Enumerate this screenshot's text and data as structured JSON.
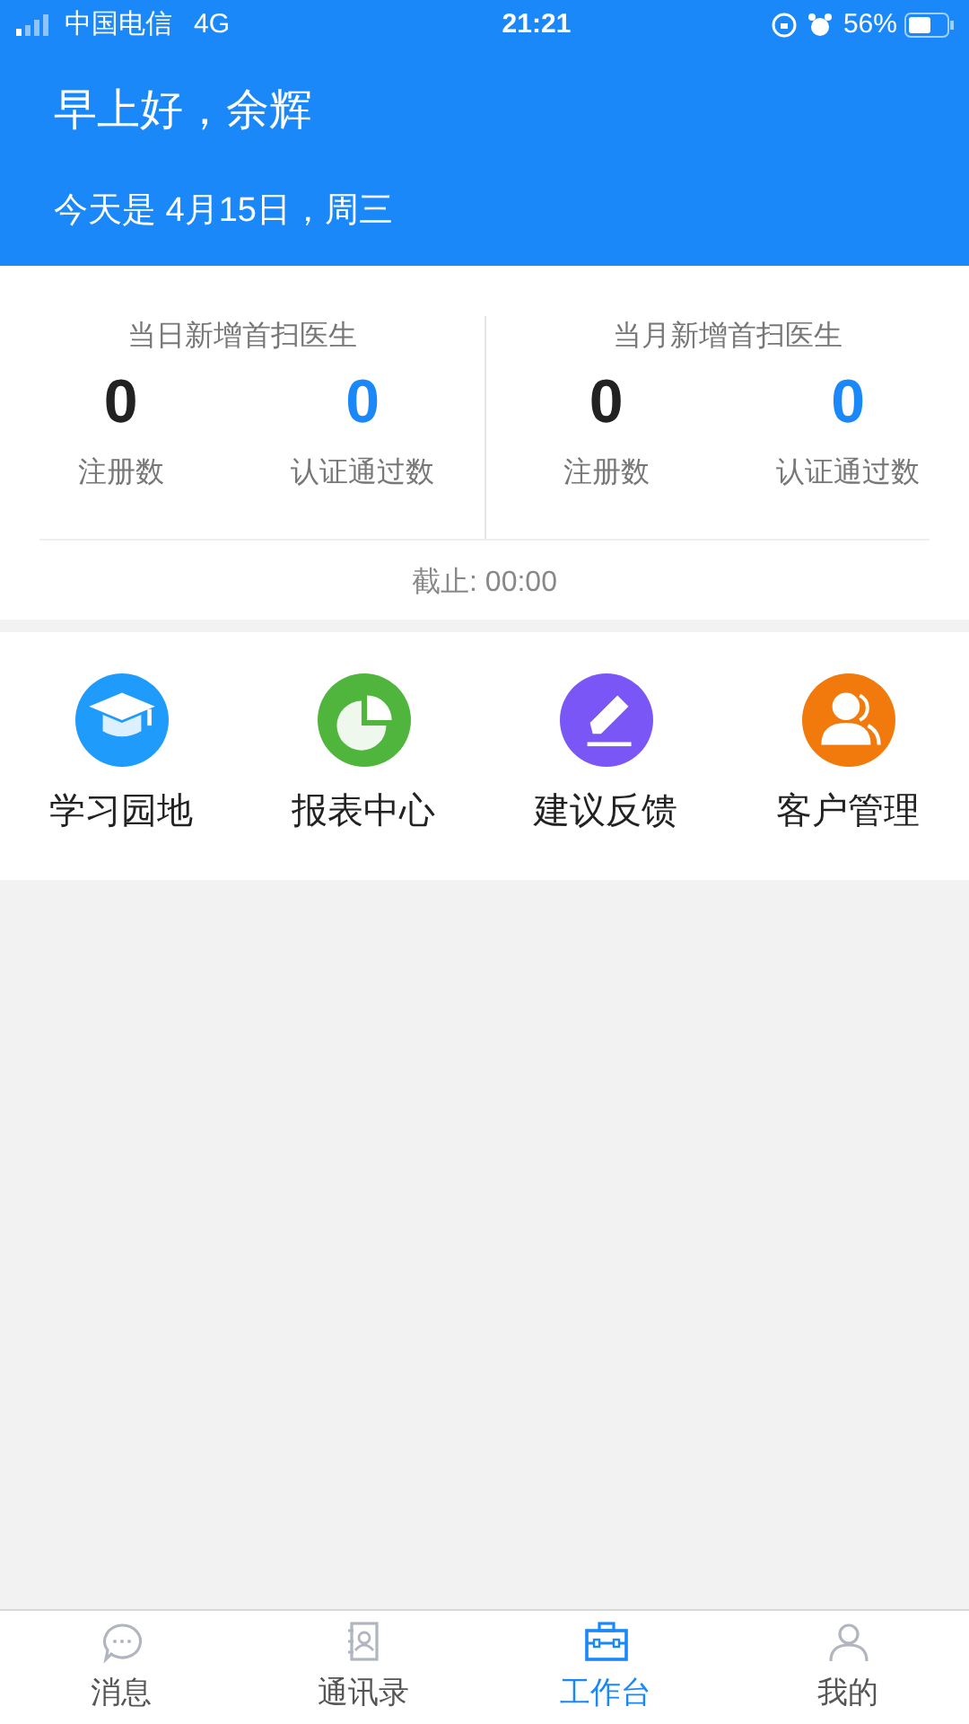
{
  "status_bar": {
    "carrier": "中国电信",
    "network": "4G",
    "time": "21:21",
    "battery": "56%"
  },
  "header": {
    "greeting": "早上好，余辉",
    "date": "今天是 4月15日，周三"
  },
  "stats": {
    "groups": [
      {
        "title": "当日新增首扫医生",
        "items": [
          {
            "value": "0",
            "label": "注册数",
            "color": "#222222"
          },
          {
            "value": "0",
            "label": "认证通过数",
            "color": "#1a88f8"
          }
        ]
      },
      {
        "title": "当月新增首扫医生",
        "items": [
          {
            "value": "0",
            "label": "注册数",
            "color": "#222222"
          },
          {
            "value": "0",
            "label": "认证通过数",
            "color": "#1a88f8"
          }
        ]
      }
    ],
    "deadline": "截止: 00:00"
  },
  "menu": [
    {
      "label": "学习园地",
      "kind": "cap",
      "color": "#1f9bfb"
    },
    {
      "label": "报表中心",
      "kind": "pie",
      "color": "#4fb53c"
    },
    {
      "label": "建议反馈",
      "kind": "pen",
      "color": "#7b56f6"
    },
    {
      "label": "客户管理",
      "kind": "people",
      "color": "#f27a0d"
    }
  ],
  "tab_bar": [
    {
      "label": "消息",
      "kind": "chat",
      "selected": false
    },
    {
      "label": "通讯录",
      "kind": "contacts",
      "selected": false
    },
    {
      "label": "工作台",
      "kind": "briefcase",
      "selected": true
    },
    {
      "label": "我的",
      "kind": "person",
      "selected": false
    }
  ]
}
